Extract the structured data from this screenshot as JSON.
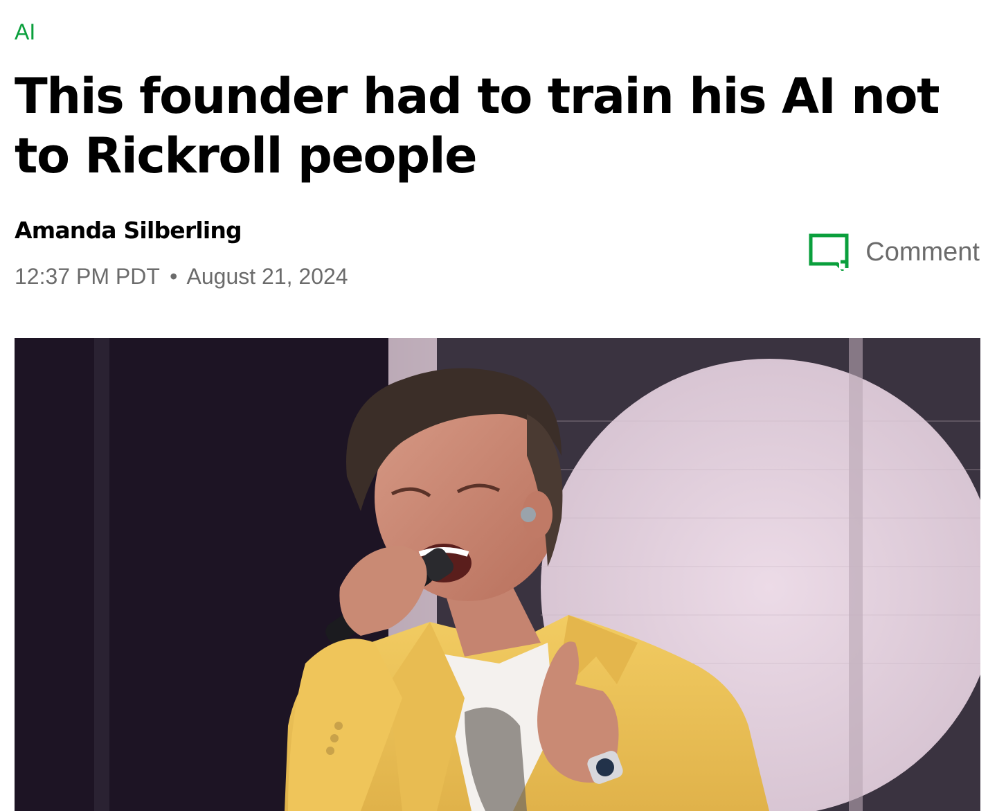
{
  "article": {
    "category": "AI",
    "headline": "This founder had to train his AI not to Rickroll people",
    "author": "Amanda Silberling",
    "time": "12:37 PM PDT",
    "separator": "•",
    "date": "August 21, 2024"
  },
  "actions": {
    "comment_label": "Comment",
    "comment_icon": "comment-bubble-icon"
  },
  "colors": {
    "accent": "#0a9f3c",
    "meta_text": "#6b6b6b",
    "headline_text": "#000000"
  },
  "hero_image": {
    "subject": "singer-performing-with-microphone"
  }
}
